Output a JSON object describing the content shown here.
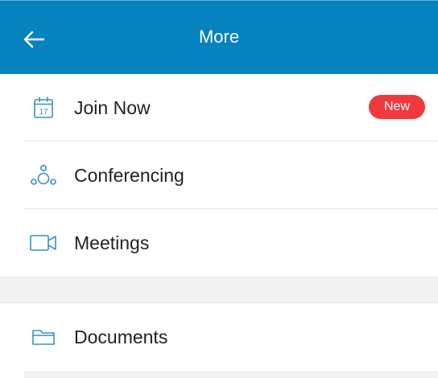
{
  "header": {
    "title": "More",
    "back_icon": "arrow-left-icon"
  },
  "menu": {
    "items": [
      {
        "label": "Join Now",
        "icon": "calendar-icon",
        "badge": "New"
      },
      {
        "label": "Conferencing",
        "icon": "conferencing-icon"
      },
      {
        "label": "Meetings",
        "icon": "video-camera-icon"
      }
    ],
    "section2": [
      {
        "label": "Documents",
        "icon": "folder-icon"
      }
    ]
  },
  "colors": {
    "header_bg": "#0682bf",
    "accent": "#3a8fc2",
    "badge_bg": "#f0393f"
  }
}
